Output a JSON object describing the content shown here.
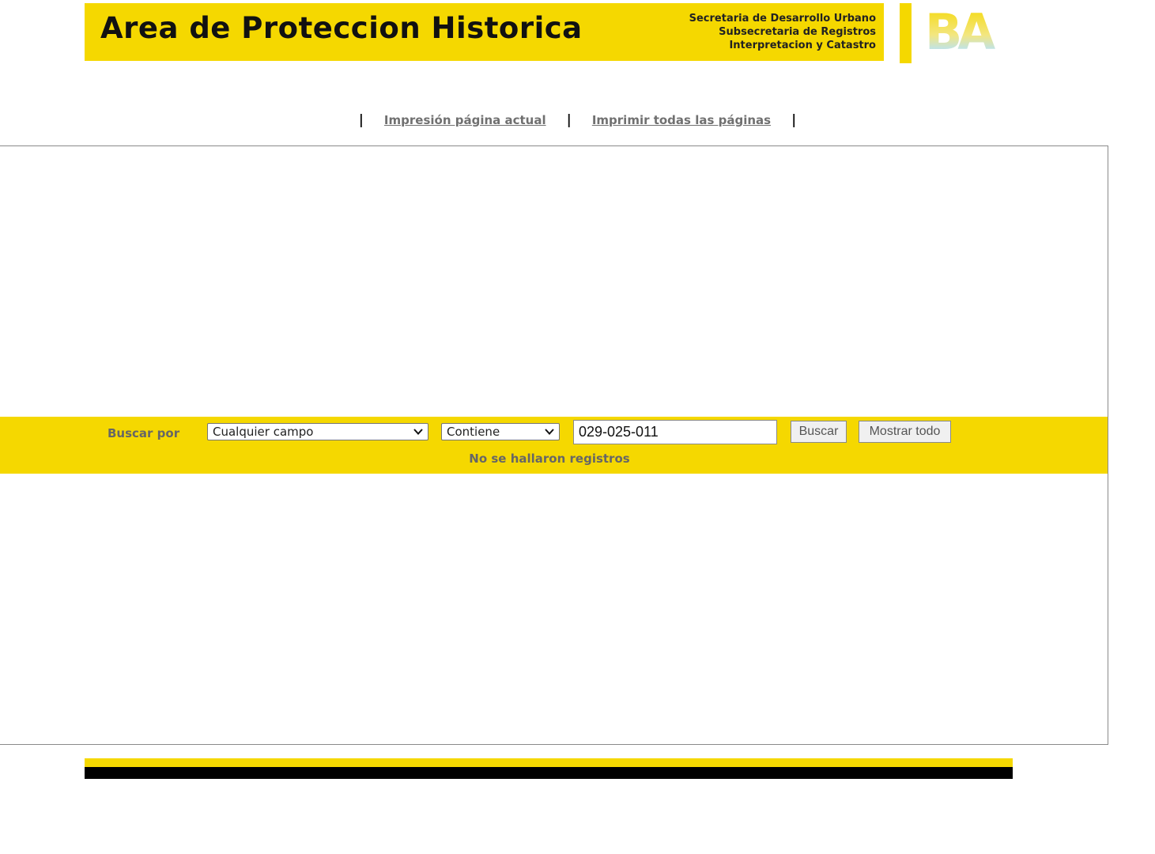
{
  "header": {
    "title": "Area de Proteccion Historica",
    "subtitles": [
      "Secretaria de Desarrollo Urbano",
      "Subsecretaria de Registros",
      "Interpretacion y Catastro"
    ],
    "logo_text": "BA",
    "brand_color": "#f5d800"
  },
  "print_links": {
    "current_page": "Impresión página actual",
    "all_pages": "Imprimir todas las páginas",
    "separator": "|"
  },
  "search": {
    "label": "Buscar por",
    "field_selected": "Cualquier campo",
    "operator_selected": "Contiene",
    "query_value": "029-025-011",
    "search_button": "Buscar",
    "show_all_button": "Mostrar todo",
    "status": "No se hallaron registros"
  },
  "icons": {
    "dropdown": "chevron-down-icon"
  }
}
